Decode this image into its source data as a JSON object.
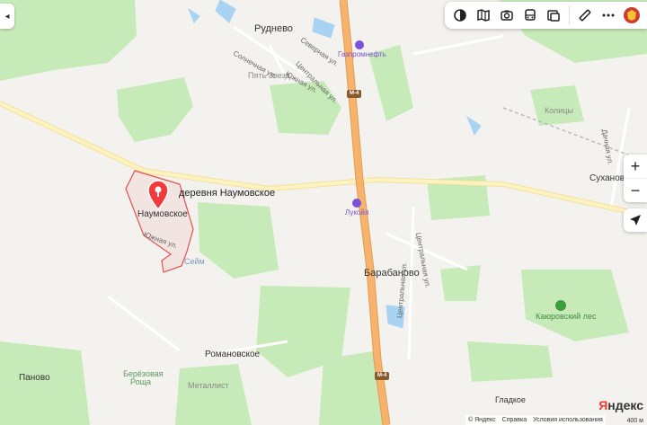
{
  "controls": {
    "back_arrow": "◂",
    "zoom_in": "+",
    "zoom_out": "−"
  },
  "toolbar_icons": [
    "layers-icon",
    "map-book-icon",
    "camera-icon",
    "bus-icon",
    "panorama-icon",
    "ruler-icon",
    "more-icon",
    "coat-of-arms-icon"
  ],
  "places": {
    "rudnevo": "Руднево",
    "naumovskoe_village_title": "деревня Наумовское",
    "naumovskoe": "Наумовское",
    "sukhanovo": "Суханово",
    "barabanovo": "Барабаново",
    "romanovskoe": "Романовское",
    "panovo": "Паново",
    "gladkoe": "Гладкое",
    "kolitsy": "Колицы",
    "seim": "Сейм",
    "pyat_zvezd": "Пять Звезд",
    "beryozovaya_roshcha_1": "Берёзовая",
    "beryozovaya_roshcha_2": "Роща",
    "metallist": "Металлист",
    "forest": "Каюровский лес"
  },
  "streets": {
    "severnaya": "Северная ул.",
    "solnechnaya": "Солнечная ул.",
    "tsentralnaya_top": "Центральная ул.",
    "yuzhnaya": "Южная ул.",
    "yuzhnaya_naum": "Южная ул.",
    "tsentralnaya_bar": "Центральная ул.",
    "tsentralnaya_low": "Центральная ул.",
    "dachnaya": "Дачная ул."
  },
  "highways": {
    "m4_top": "М-4",
    "m4_bottom": "М-4"
  },
  "pois": {
    "gazpromneft": "Газпромнефть",
    "lukoil": "Лукойл"
  },
  "footer": {
    "copyright": "© Яндекс",
    "help": "Справка",
    "terms": "Условия использования"
  },
  "logo": {
    "first": "Я",
    "rest": "ндекс"
  },
  "scale": "400 м",
  "colors": {
    "background": "#f4f2ee",
    "forest": "#c7eab9",
    "highway": "#f6b36e",
    "road": "#fdf3c2",
    "water": "#a9d3f3",
    "boundary": "#e35050",
    "pin": "#f23a3a",
    "poi": "#7b4fd8"
  }
}
